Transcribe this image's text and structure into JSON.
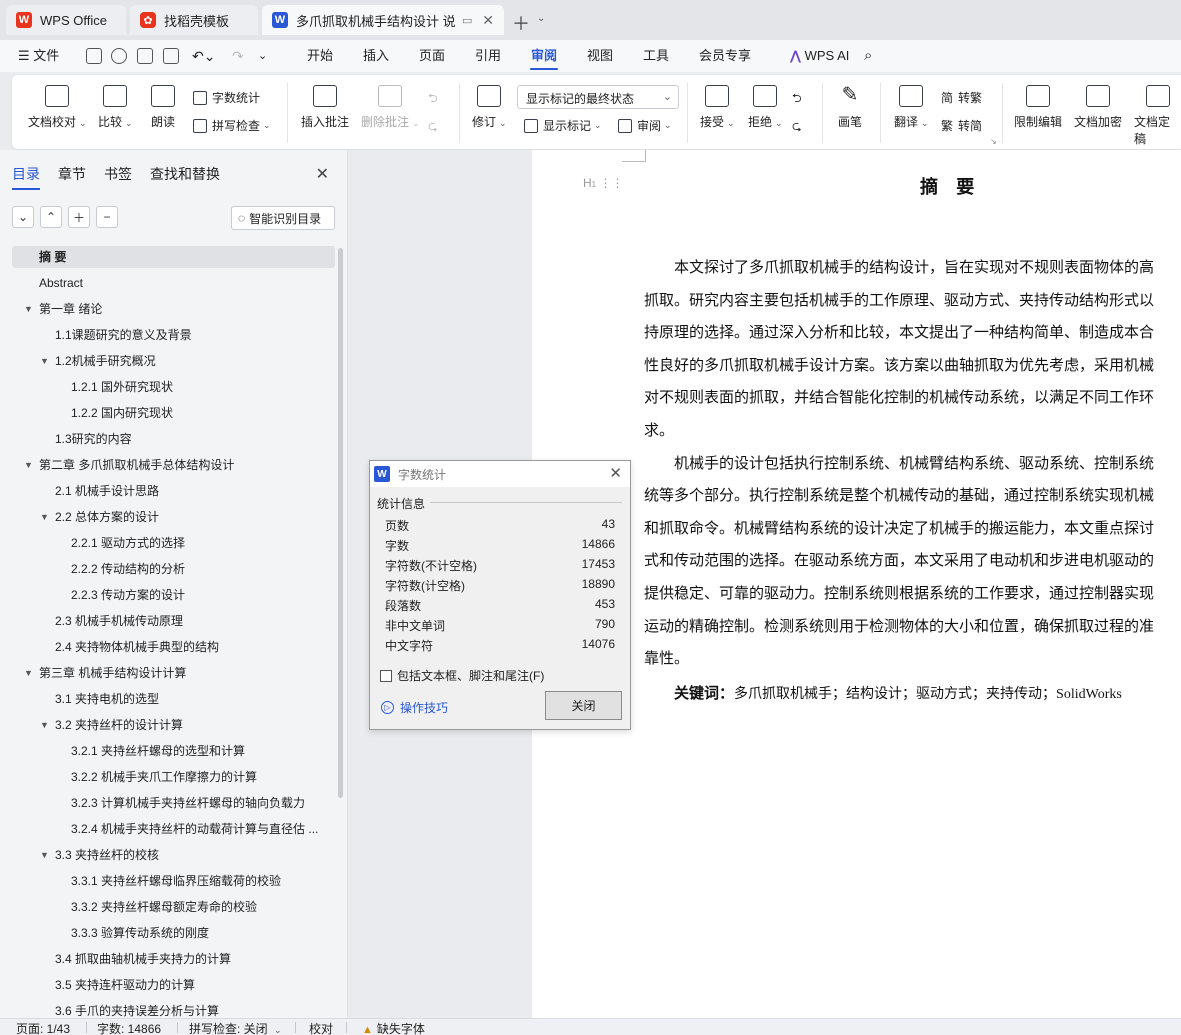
{
  "tabs": [
    {
      "label": "WPS Office",
      "icon": "wps-logo-icon"
    },
    {
      "label": "找稻壳模板",
      "icon": "docer-icon"
    },
    {
      "label": "多爪抓取机械手结构设计 说明",
      "icon": "word-doc-icon"
    }
  ],
  "menu": {
    "file": "文件",
    "items": [
      "开始",
      "插入",
      "页面",
      "引用",
      "审阅",
      "视图",
      "工具",
      "会员专享"
    ],
    "active": "审阅",
    "ai": "WPS AI"
  },
  "ribbon": {
    "doc_check": "文档校对",
    "compare": "比较",
    "read_aloud": "朗读",
    "word_count": "字数统计",
    "spell_check": "拼写检查",
    "insert_comment": "插入批注",
    "delete_comment": "删除批注",
    "track": "修订",
    "markup_state": "显示标记的最终状态",
    "show_markup": "显示标记",
    "review_pane": "审阅",
    "accept": "接受",
    "reject": "拒绝",
    "pen": "画笔",
    "translate": "翻译",
    "to_traditional": "转繁",
    "to_simplified": "转简",
    "restrict_edit": "限制编辑",
    "encrypt": "文档加密",
    "finalize": "文档定稿"
  },
  "nav": {
    "tabs": [
      "目录",
      "章节",
      "书签",
      "查找和替换"
    ],
    "smart_toc": "智能识别目录",
    "toc": [
      {
        "text": "摘 要",
        "level": 0,
        "caret": false,
        "selected": true
      },
      {
        "text": "Abstract",
        "level": 0,
        "caret": false
      },
      {
        "text": "第一章 绪论",
        "level": 0,
        "caret": true
      },
      {
        "text": "1.1课题研究的意义及背景",
        "level": 1,
        "caret": false
      },
      {
        "text": "1.2机械手研究概况",
        "level": 1,
        "caret": true
      },
      {
        "text": "1.2.1 国外研究现状",
        "level": 2,
        "caret": false
      },
      {
        "text": "1.2.2 国内研究现状",
        "level": 2,
        "caret": false
      },
      {
        "text": "1.3研究的内容",
        "level": 1,
        "caret": false
      },
      {
        "text": "第二章 多爪抓取机械手总体结构设计",
        "level": 0,
        "caret": true
      },
      {
        "text": "2.1 机械手设计思路",
        "level": 1,
        "caret": false
      },
      {
        "text": "2.2 总体方案的设计",
        "level": 1,
        "caret": true
      },
      {
        "text": "2.2.1 驱动方式的选择",
        "level": 2,
        "caret": false
      },
      {
        "text": "2.2.2 传动结构的分析",
        "level": 2,
        "caret": false
      },
      {
        "text": "2.2.3 传动方案的设计",
        "level": 2,
        "caret": false
      },
      {
        "text": "2.3 机械手机械传动原理",
        "level": 1,
        "caret": false
      },
      {
        "text": "2.4 夹持物体机械手典型的结构",
        "level": 1,
        "caret": false
      },
      {
        "text": "第三章 机械手结构设计计算",
        "level": 0,
        "caret": true
      },
      {
        "text": "3.1 夹持电机的选型",
        "level": 1,
        "caret": false
      },
      {
        "text": "3.2 夹持丝杆的设计计算",
        "level": 1,
        "caret": true
      },
      {
        "text": "3.2.1 夹持丝杆螺母的选型和计算",
        "level": 2,
        "caret": false
      },
      {
        "text": "3.2.2 机械手夹爪工作摩擦力的计算",
        "level": 2,
        "caret": false
      },
      {
        "text": "3.2.3 计算机械手夹持丝杆螺母的轴向负载力",
        "level": 2,
        "caret": false
      },
      {
        "text": "3.2.4 机械手夹持丝杆的动载荷计算与直径估 ...",
        "level": 2,
        "caret": false
      },
      {
        "text": "3.3 夹持丝杆的校核",
        "level": 1,
        "caret": true
      },
      {
        "text": "3.3.1 夹持丝杆螺母临界压缩载荷的校验",
        "level": 2,
        "caret": false
      },
      {
        "text": "3.3.2 夹持丝杆螺母额定寿命的校验",
        "level": 2,
        "caret": false
      },
      {
        "text": "3.3.3 验算传动系统的刚度",
        "level": 2,
        "caret": false
      },
      {
        "text": "3.4 抓取曲轴机械手夹持力的计算",
        "level": 1,
        "caret": false
      },
      {
        "text": "3.5 夹持连杆驱动力的计算",
        "level": 1,
        "caret": false
      },
      {
        "text": "3.6 手爪的夹持误差分析与计算",
        "level": 1,
        "caret": false
      }
    ]
  },
  "document": {
    "heading_marker": "H",
    "title": "摘 要",
    "lines": [
      "　　本文探讨了多爪抓取机械手的结构设计，旨在实现对不规则表面物体的高",
      "抓取。研究内容主要包括机械手的工作原理、驱动方式、夹持传动结构形式以",
      "持原理的选择。通过深入分析和比较，本文提出了一种结构简单、制造成本合",
      "性良好的多爪抓取机械手设计方案。该方案以曲轴抓取为优先考虑，采用机械",
      "对不规则表面的抓取，并结合智能化控制的机械传动系统，以满足不同工作环",
      "求。",
      "　　机械手的设计包括执行控制系统、机械臂结构系统、驱动系统、控制系统",
      "统等多个部分。执行控制系统是整个机械传动的基础，通过控制系统实现机械",
      "和抓取命令。机械臂结构系统的设计决定了机械手的搬运能力，本文重点探讨",
      "式和传动范围的选择。在驱动系统方面，本文采用了电动机和步进电机驱动的",
      "提供稳定、可靠的驱动力。控制系统则根据系统的工作要求，通过控制器实现",
      "运动的精确控制。检测系统则用于检测物体的大小和位置，确保抓取过程的准",
      "靠性。"
    ],
    "keywords_label": "关键词：",
    "keywords": "多爪抓取机械手；结构设计；驱动方式；夹持传动；SolidWorks"
  },
  "dialog": {
    "title": "字数统计",
    "group": "统计信息",
    "stats": [
      {
        "label": "页数",
        "value": "43"
      },
      {
        "label": "字数",
        "value": "14866"
      },
      {
        "label": "字符数(不计空格)",
        "value": "17453"
      },
      {
        "label": "字符数(计空格)",
        "value": "18890"
      },
      {
        "label": "段落数",
        "value": "453"
      },
      {
        "label": "非中文单词",
        "value": "790"
      },
      {
        "label": "中文字符",
        "value": "14076"
      }
    ],
    "checkbox": "包括文本框、脚注和尾注(F)",
    "tips": "操作技巧",
    "close": "关闭"
  },
  "status": {
    "page": "页面: 1/43",
    "words": "字数: 14866",
    "spell": "拼写检查: 关闭",
    "proof": "校对",
    "missing_font": "缺失字体"
  },
  "colors": {
    "accent": "#2a57d6",
    "wps_red": "#e8341c",
    "warn": "#d48a00"
  }
}
